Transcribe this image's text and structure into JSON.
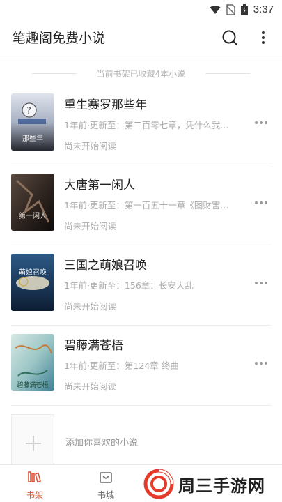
{
  "status_bar": {
    "time": "3:37"
  },
  "app_bar": {
    "title": "笔趣阁免费小说"
  },
  "shelf_info": "当前书架已收藏4本小说",
  "books": [
    {
      "title": "重生赛罗那些年",
      "update": "1年前·更新至：第二百零七章，凭什么我...",
      "status": "尚未开始阅读",
      "cover_text": "那些年",
      "cover_colors": [
        "#d9dde6",
        "#2a2c33"
      ]
    },
    {
      "title": "大唐第一闲人",
      "update": "1年前·更新至：第一百五十一章《图财害...",
      "status": "尚未开始阅读",
      "cover_text": "第一闲人",
      "cover_colors": [
        "#3c2f2a",
        "#141010"
      ]
    },
    {
      "title": "三国之萌娘召唤",
      "update": "1年前·更新至：156章：长安大乱",
      "status": "尚未开始阅读",
      "cover_text": "萌娘召唤",
      "cover_colors": [
        "#1d3a5c",
        "#0f2036"
      ]
    },
    {
      "title": "碧藤满苍梧",
      "update": "1年前·更新至：第124章 终曲",
      "status": "尚未开始阅读",
      "cover_text": "碧藤满苍梧",
      "cover_colors": [
        "#cfe3e0",
        "#4a8fa0"
      ]
    }
  ],
  "add_prompt": "添加你喜欢的小说",
  "bottom_nav": [
    {
      "label": "书架",
      "icon": "bookshelf-icon",
      "active": true
    },
    {
      "label": "书城",
      "icon": "bookstore-icon",
      "active": false
    }
  ],
  "watermark": "周三手游网",
  "colors": {
    "accent": "#e0533b",
    "watermark_red": "#e63a2a"
  }
}
